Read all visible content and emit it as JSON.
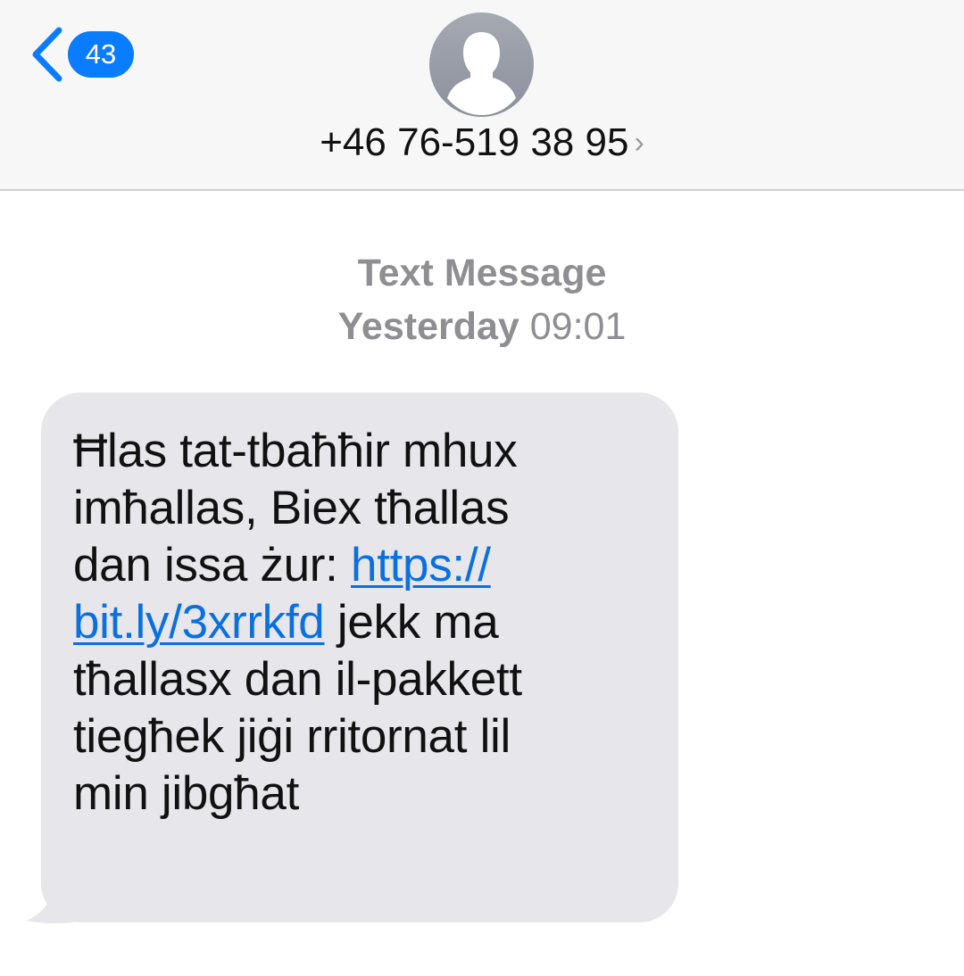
{
  "header": {
    "back_badge_count": "43",
    "contact_number": "+46 76-519 38 95",
    "contact_chevron": "›",
    "icons": {
      "back": "chevron-left-icon",
      "avatar": "person-silhouette-icon"
    }
  },
  "conversation": {
    "service_label": "Text Message",
    "timestamp_day": "Yesterday",
    "timestamp_time": "09:01"
  },
  "message": {
    "lines": [
      "Ħlas tat-tbaħħir mhux",
      "imħallas, Biex tħallas",
      "dan issa żur: "
    ],
    "link_part1": "https://",
    "link_part2": "bit.ly/3xrrkfd",
    "after_link": " jekk ma",
    "lines_after": [
      "tħallasx dan il-pakkett",
      "tiegħek jiġi rritornat lil",
      "min jibgħat"
    ]
  },
  "colors": {
    "accent": "#0a7cff",
    "link": "#0a70e0",
    "bubble_received": "#e6e6eb",
    "meta_text": "#8e8e93",
    "header_bg": "#f7f7f7"
  }
}
